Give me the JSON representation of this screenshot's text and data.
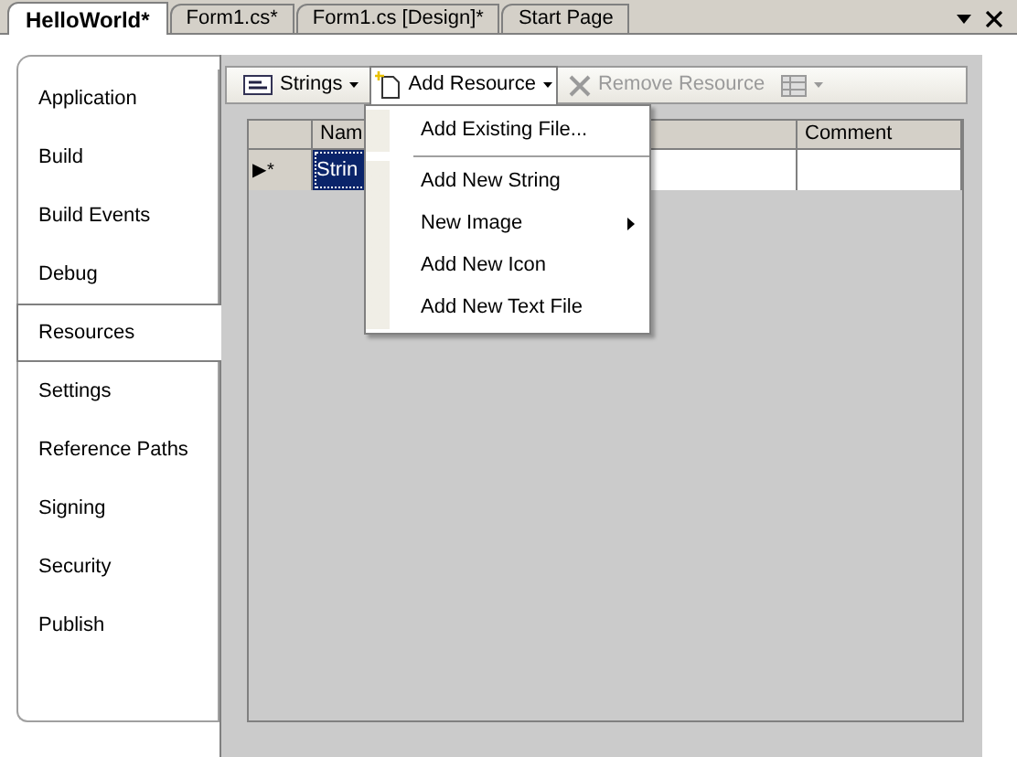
{
  "tabs": [
    {
      "label": "HelloWorld*",
      "selected": true
    },
    {
      "label": "Form1.cs*",
      "selected": false
    },
    {
      "label": "Form1.cs [Design]*",
      "selected": false
    },
    {
      "label": "Start Page",
      "selected": false
    }
  ],
  "sidebar": {
    "items": [
      {
        "label": "Application",
        "selected": false
      },
      {
        "label": "Build",
        "selected": false
      },
      {
        "label": "Build Events",
        "selected": false
      },
      {
        "label": "Debug",
        "selected": false
      },
      {
        "label": "Resources",
        "selected": true
      },
      {
        "label": "Settings",
        "selected": false
      },
      {
        "label": "Reference Paths",
        "selected": false
      },
      {
        "label": "Signing",
        "selected": false
      },
      {
        "label": "Security",
        "selected": false
      },
      {
        "label": "Publish",
        "selected": false
      }
    ]
  },
  "toolbar": {
    "buttons": [
      {
        "kind": "category",
        "label": "Strings",
        "disabled": false,
        "pressed": false
      },
      {
        "kind": "add",
        "label": "Add Resource",
        "disabled": false,
        "pressed": true
      },
      {
        "kind": "remove",
        "label": "Remove Resource",
        "disabled": true,
        "pressed": false
      },
      {
        "kind": "views",
        "disabled": true,
        "pressed": false
      }
    ]
  },
  "menu": {
    "items": [
      {
        "kind": "item",
        "label": "Add Existing File..."
      },
      {
        "kind": "separator"
      },
      {
        "kind": "item",
        "label": "Add New String"
      },
      {
        "kind": "submenu",
        "label": "New Image"
      },
      {
        "kind": "item",
        "label": "Add New Icon"
      },
      {
        "kind": "item",
        "label": "Add New Text File"
      }
    ]
  },
  "grid": {
    "columns": [
      {
        "label": "Nam"
      },
      {
        "label": "Comment"
      }
    ],
    "rows": [
      {
        "marker": "▶*",
        "cells": [
          {
            "text": "Strin",
            "selected": true
          },
          {
            "selected": false
          },
          {
            "selected": false
          }
        ]
      }
    ]
  }
}
